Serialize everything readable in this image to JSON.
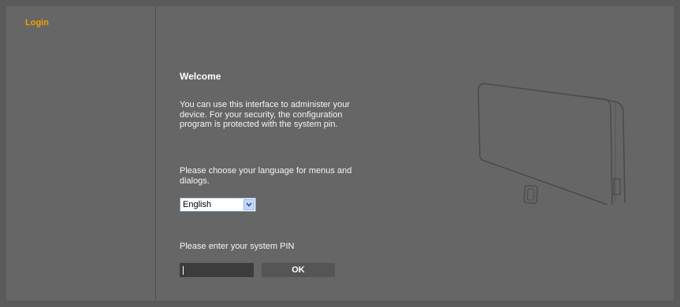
{
  "sidebar": {
    "login_label": "Login"
  },
  "main": {
    "title": "Welcome",
    "intro": "You can use this interface to administer your device. For your security, the configuration program is protected with the system pin.",
    "language_prompt": "Please choose your language for menus and dialogs.",
    "language_selected": "English",
    "pin_prompt": "Please enter your system PIN",
    "pin_value": "",
    "ok_label": "OK"
  },
  "colors": {
    "background": "#666666",
    "accent": "#f0a000",
    "input_dark": "#3c3c3c",
    "button": "#555555"
  },
  "icons": {
    "dropdown": "chevron-down-icon",
    "device": "base-station-image"
  }
}
